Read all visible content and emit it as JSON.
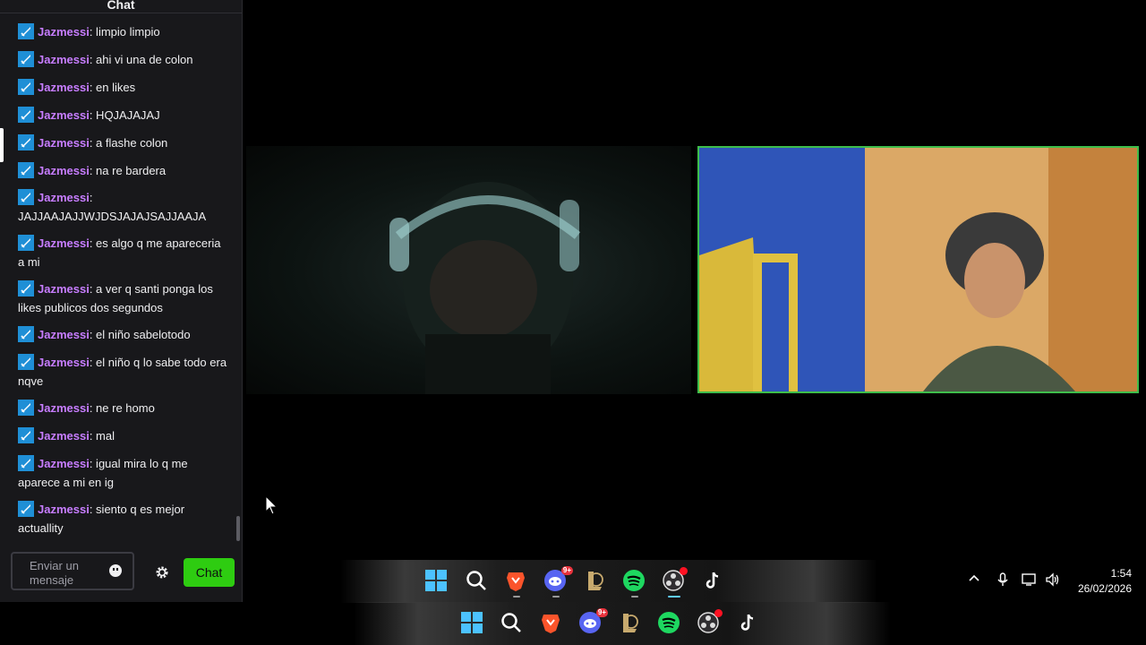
{
  "chat": {
    "title": "Chat",
    "messages": [
      {
        "user": "Jazmessi",
        "text": ": limpio limpio"
      },
      {
        "user": "Jazmessi",
        "text": ": ahi vi una de colon"
      },
      {
        "user": "Jazmessi",
        "text": ": en likes"
      },
      {
        "user": "Jazmessi",
        "text": ": HQJAJAJAJ"
      },
      {
        "user": "Jazmessi",
        "text": ": a flashe colon"
      },
      {
        "user": "Jazmessi",
        "text": ": na re bardera"
      },
      {
        "user": "Jazmessi",
        "text": ": JAJJAAJAJJWJDSJAJAJSAJJAAJA"
      },
      {
        "user": "Jazmessi",
        "text": ": es algo q me apareceria a mi"
      },
      {
        "user": "Jazmessi",
        "text": ": a ver q santi ponga los likes publicos dos segundos"
      },
      {
        "user": "Jazmessi",
        "text": ": el niño sabelotodo"
      },
      {
        "user": "Jazmessi",
        "text": ": el niño q lo sabe todo era nqve"
      },
      {
        "user": "Jazmessi",
        "text": ": ne re homo"
      },
      {
        "user": "Jazmessi",
        "text": ": mal"
      },
      {
        "user": "Jazmessi",
        "text": ": igual mira lo q me aparece a mi en ig"
      },
      {
        "user": "Jazmessi",
        "text": ": siento q es mejor actuallity"
      }
    ],
    "input_placeholder": "Enviar un mensaje",
    "send_label": "Chat",
    "accent_color": "#2ecc11",
    "username_color": "#c77dff"
  },
  "taskbar": {
    "apps": [
      "windows-start",
      "search",
      "brave",
      "discord",
      "league-of-legends",
      "spotify",
      "obs",
      "tiktok"
    ],
    "discord_badge": "9+"
  },
  "tray": {
    "time": "1:54",
    "date": "26/02/2026"
  }
}
